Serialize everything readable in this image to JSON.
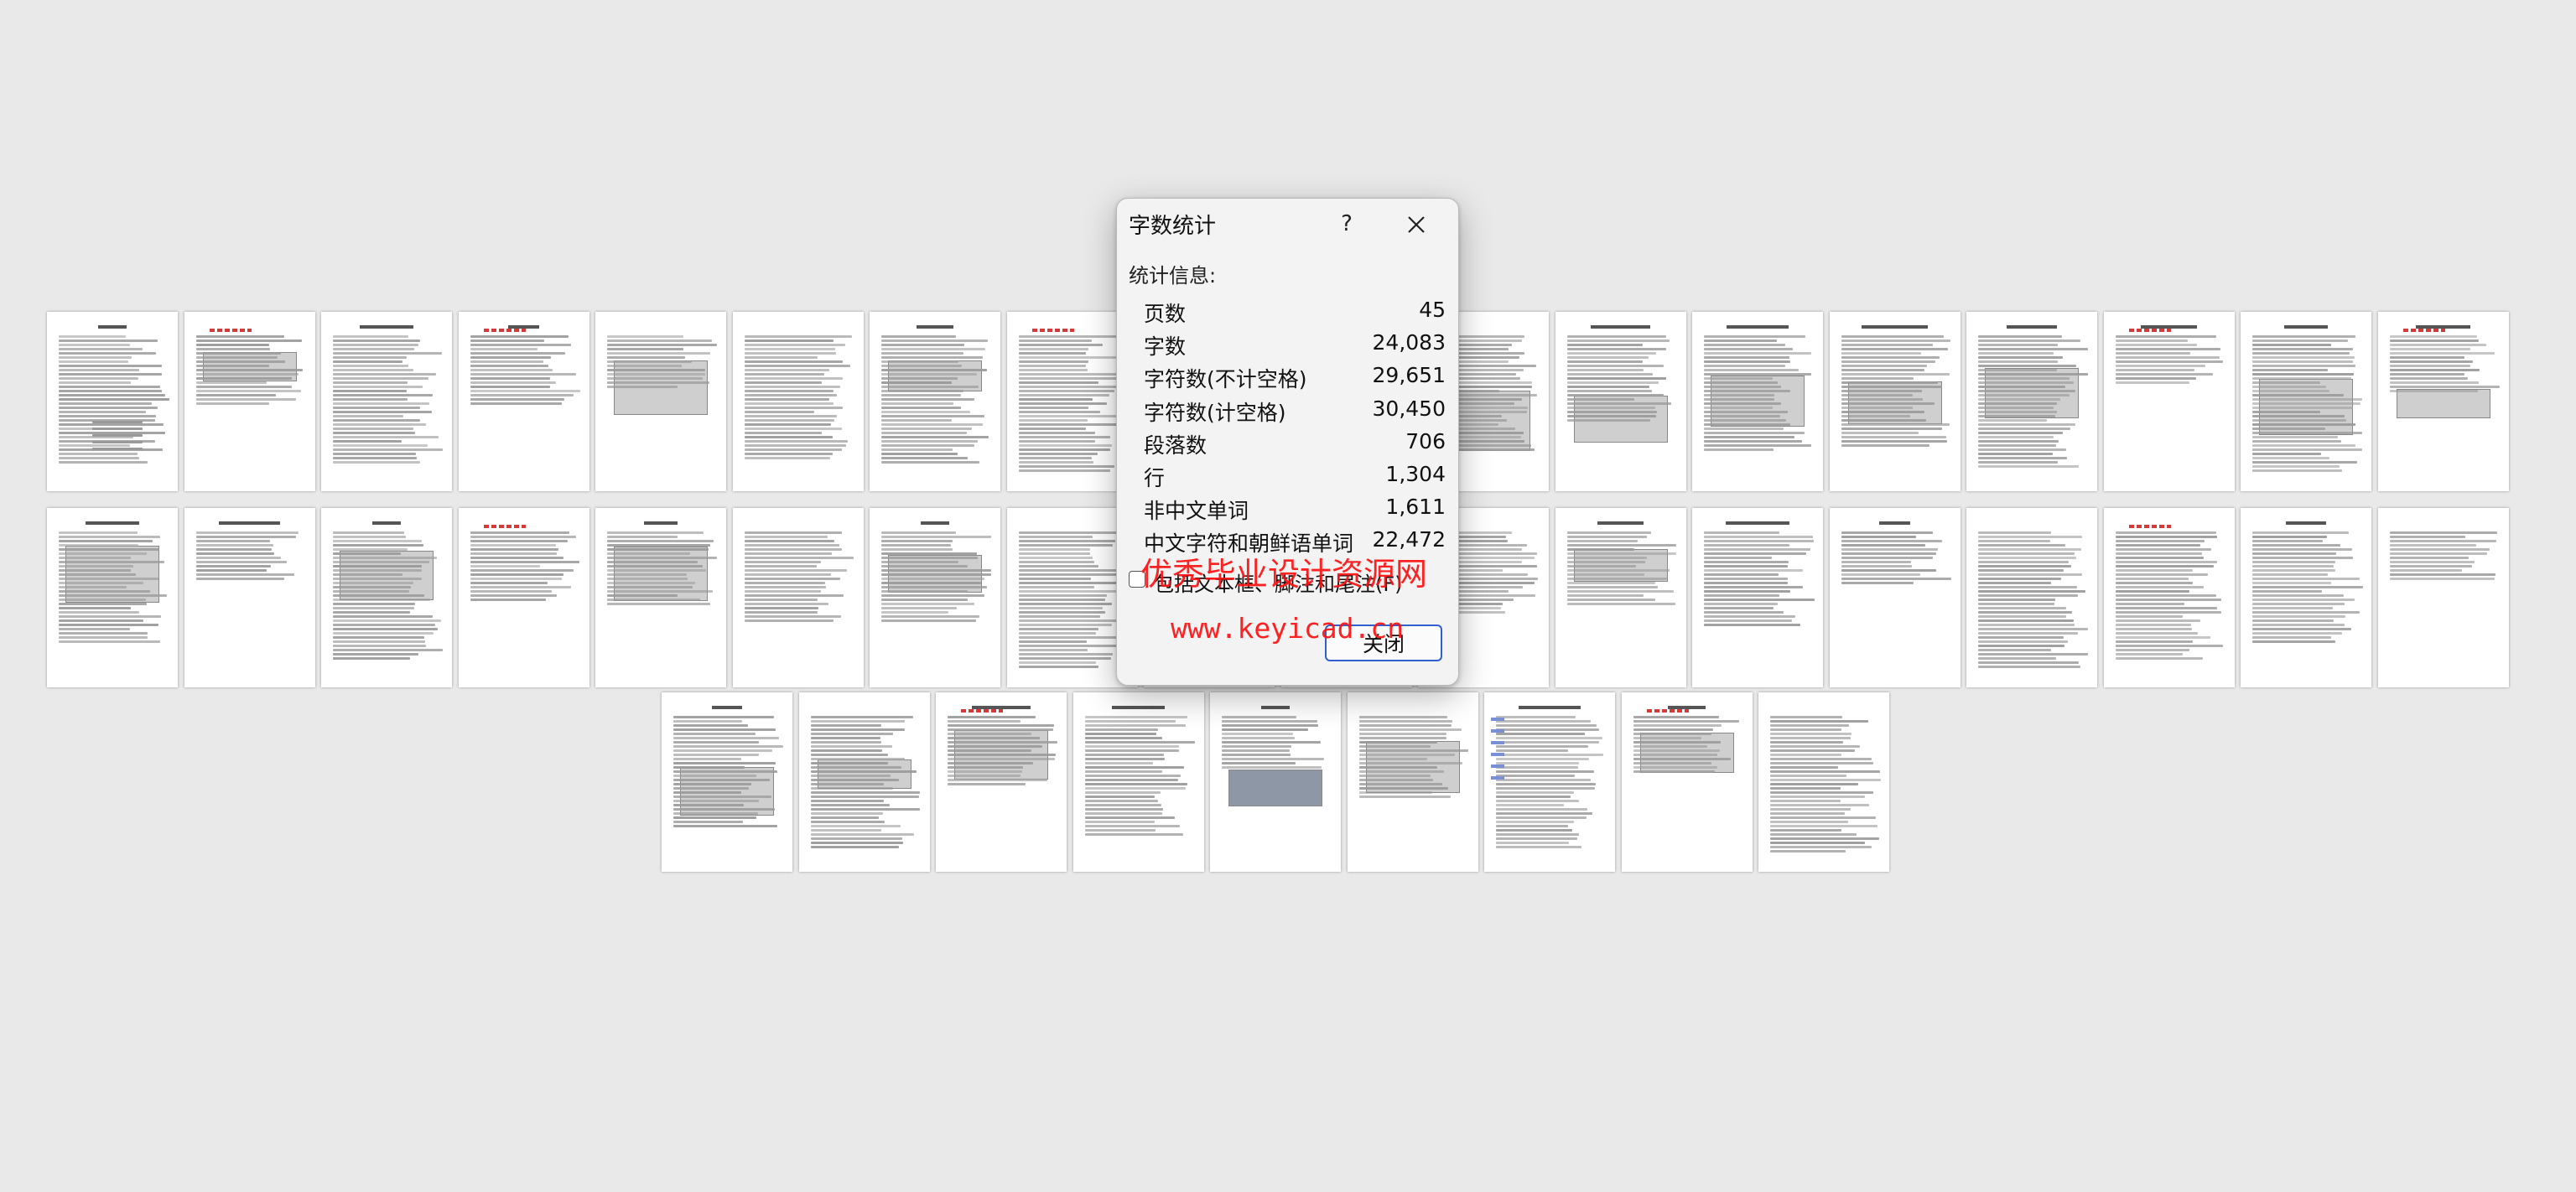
{
  "dialog": {
    "title": "字数统计",
    "help_label": "?",
    "close_icon": "close-icon",
    "stats_heading": "统计信息:",
    "stats": [
      {
        "label": "页数",
        "value": "45"
      },
      {
        "label": "字数",
        "value": "24,083"
      },
      {
        "label": "字符数(不计空格)",
        "value": "29,651"
      },
      {
        "label": "字符数(计空格)",
        "value": "30,450"
      },
      {
        "label": "段落数",
        "value": "706"
      },
      {
        "label": "行",
        "value": "1,304"
      },
      {
        "label": "非中文单词",
        "value": "1,611"
      },
      {
        "label": "中文字符和朝鲜语单词",
        "value": "22,472"
      }
    ],
    "include_label": "包括文本框、脚注和尾注(F)",
    "include_checked": false,
    "close_button_label": "关闭"
  },
  "watermark": {
    "line1": "优秀毕业设计资源网",
    "line2": "www.keyicad.cn",
    "color": "#ff1010"
  },
  "document": {
    "page_count_visible": 45
  }
}
